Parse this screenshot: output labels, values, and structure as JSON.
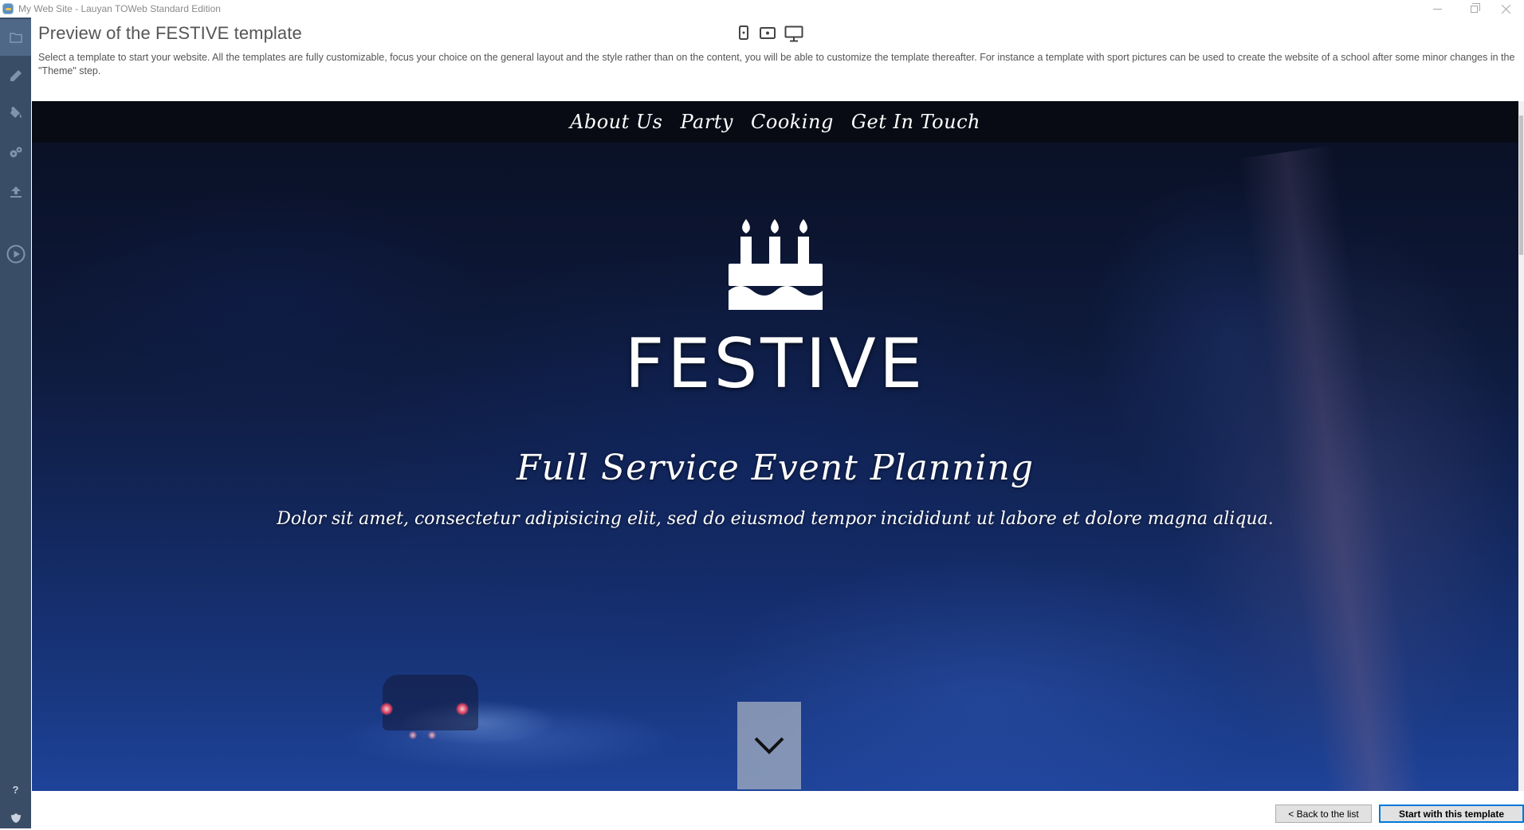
{
  "window": {
    "title": "My Web Site - Lauyan TOWeb Standard Edition",
    "controls": [
      "minimize",
      "restore",
      "close"
    ]
  },
  "sidebar": {
    "items": [
      {
        "icon": "folder-icon",
        "active": true
      },
      {
        "icon": "pencil-icon",
        "active": false
      },
      {
        "icon": "paint-bucket-icon",
        "active": false
      },
      {
        "icon": "gears-icon",
        "active": false
      },
      {
        "icon": "upload-icon",
        "active": false
      },
      {
        "icon": "play-circle-icon",
        "active": false
      }
    ],
    "bottom_items": [
      {
        "icon": "help-icon",
        "label": "?"
      },
      {
        "icon": "shield-icon"
      }
    ]
  },
  "header": {
    "title": "Preview of the FESTIVE template",
    "description": "Select a template to start your website. All the templates are fully customizable, focus your choice on the general layout and the style rather than on the content, you will be able to customize the template thereafter. For instance a template with sport pictures can be used to create the website of a school after some minor changes in the \"Theme\" step."
  },
  "device_toggle": {
    "options": [
      "phone",
      "tablet",
      "desktop"
    ],
    "selected": "desktop"
  },
  "preview": {
    "nav": [
      "About Us",
      "Party",
      "Cooking",
      "Get In Touch"
    ],
    "logo_icon": "birthday-cake-icon",
    "hero_title": "FESTIVE",
    "hero_subtitle": "Full Service Event Planning",
    "hero_text": "Dolor sit amet, consectetur adipisicing elit, sed do eiusmod tempor incididunt ut labore et dolore magna aliqua.",
    "scroll_icon": "chevron-down-icon"
  },
  "footer": {
    "back_label": "< Back to the list",
    "start_label": "Start with this template"
  },
  "colors": {
    "sidebar_bg": "#3a4d66",
    "sidebar_active": "#4f6888",
    "primary_button_border": "#0078d7"
  }
}
